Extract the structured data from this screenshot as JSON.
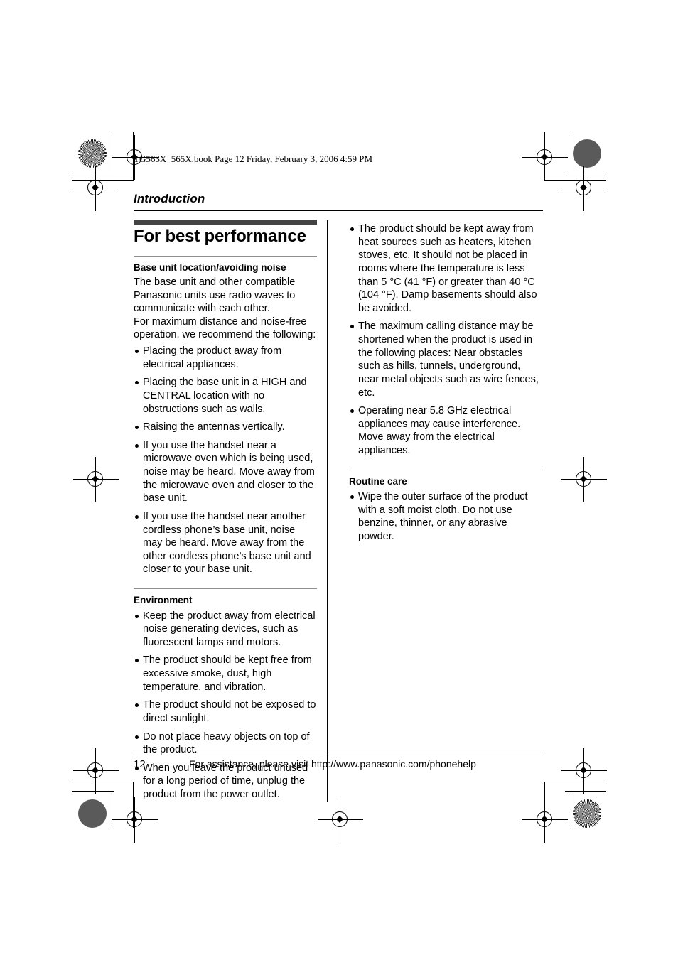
{
  "book_line": "TG563X_565X.book  Page 12  Friday, February 3, 2006  4:59 PM",
  "running_head": "Introduction",
  "title": "For best performance",
  "left_column": {
    "section1": {
      "subhead": "Base unit location/avoiding noise",
      "intro": "The base unit and other compatible Panasonic units use radio waves to communicate with each other.\nFor maximum distance and noise-free operation, we recommend the following:",
      "intro_lines": [
        "The base unit and other compatible",
        "Panasonic units use radio waves to",
        "communicate with each other.",
        "For maximum distance and noise-free",
        "operation, we recommend the following:"
      ],
      "bullets": [
        "Placing the product away from electrical appliances.",
        "Placing the base unit in a HIGH and CENTRAL location with no obstructions such as walls.",
        "Raising the antennas vertically.",
        "If you use the handset near a microwave oven which is being used, noise may be heard. Move away from the microwave oven and closer to the base unit.",
        "If you use the handset near another cordless phone’s base unit, noise may be heard. Move away from the other cordless phone’s base unit and closer to your base unit."
      ]
    },
    "section2": {
      "subhead": "Environment",
      "bullets": [
        "Keep the product away from electrical noise generating devices, such as fluorescent lamps and motors.",
        "The product should be kept free from excessive smoke, dust, high temperature, and vibration.",
        "The product should not be exposed to direct sunlight.",
        "Do not place heavy objects on top of the product.",
        "When you leave the product unused for a long period of time, unplug the product from the power outlet."
      ]
    }
  },
  "right_column": {
    "section1": {
      "bullets": [
        "The product should be kept away from heat sources such as heaters, kitchen stoves, etc. It should not be placed in rooms where the temperature is less than 5 °C (41 °F) or greater than 40 °C (104 °F). Damp basements should also be avoided.",
        "The maximum calling distance may be shortened when the product is used in the following places: Near obstacles such as hills, tunnels, underground, near metal objects such as wire fences, etc.",
        "Operating near 5.8 GHz electrical appliances may cause interference. Move away from the electrical appliances."
      ]
    },
    "section2": {
      "subhead": "Routine care",
      "bullets": [
        "Wipe the outer surface of the product with a soft moist cloth. Do not use benzine, thinner, or any abrasive powder."
      ]
    }
  },
  "footer": {
    "page_number": "12",
    "text": "For assistance, please visit http://www.panasonic.com/phonehelp"
  },
  "colors": {
    "title_bar": "#434343",
    "sub_rule": "#8e8e8e",
    "density_circle": "#5a5a5a",
    "text": "#000000"
  }
}
